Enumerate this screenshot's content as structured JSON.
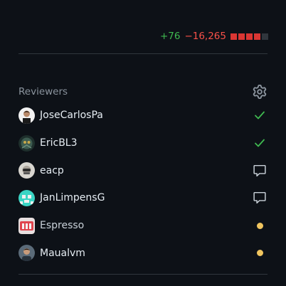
{
  "diffstat": {
    "additions": "+76",
    "deletions": "−16,265",
    "blocks": [
      "#da3633",
      "#da3633",
      "#da3633",
      "#da3633",
      "#30363d"
    ]
  },
  "reviewers": {
    "title": "Reviewers",
    "settings_icon": "gear-icon",
    "people": [
      {
        "name": "JoseCarlosPa",
        "status": "approved",
        "status_icon": "check-icon"
      },
      {
        "name": "EricBL3",
        "status": "approved",
        "status_icon": "check-icon"
      },
      {
        "name": "eacp",
        "status": "commented",
        "status_icon": "comment-icon"
      },
      {
        "name": "JanLimpensG",
        "status": "commented",
        "status_icon": "comment-icon"
      },
      {
        "name": "Espresso",
        "status": "pending",
        "status_icon": "pending-dot-icon"
      },
      {
        "name": "Maualvm",
        "status": "pending",
        "status_icon": "pending-dot-icon"
      }
    ]
  },
  "colors": {
    "approved": "#3fb950",
    "commented": "#8b949e",
    "pending": "#d29922",
    "additions": "#3fb950",
    "deletions": "#f85149"
  }
}
